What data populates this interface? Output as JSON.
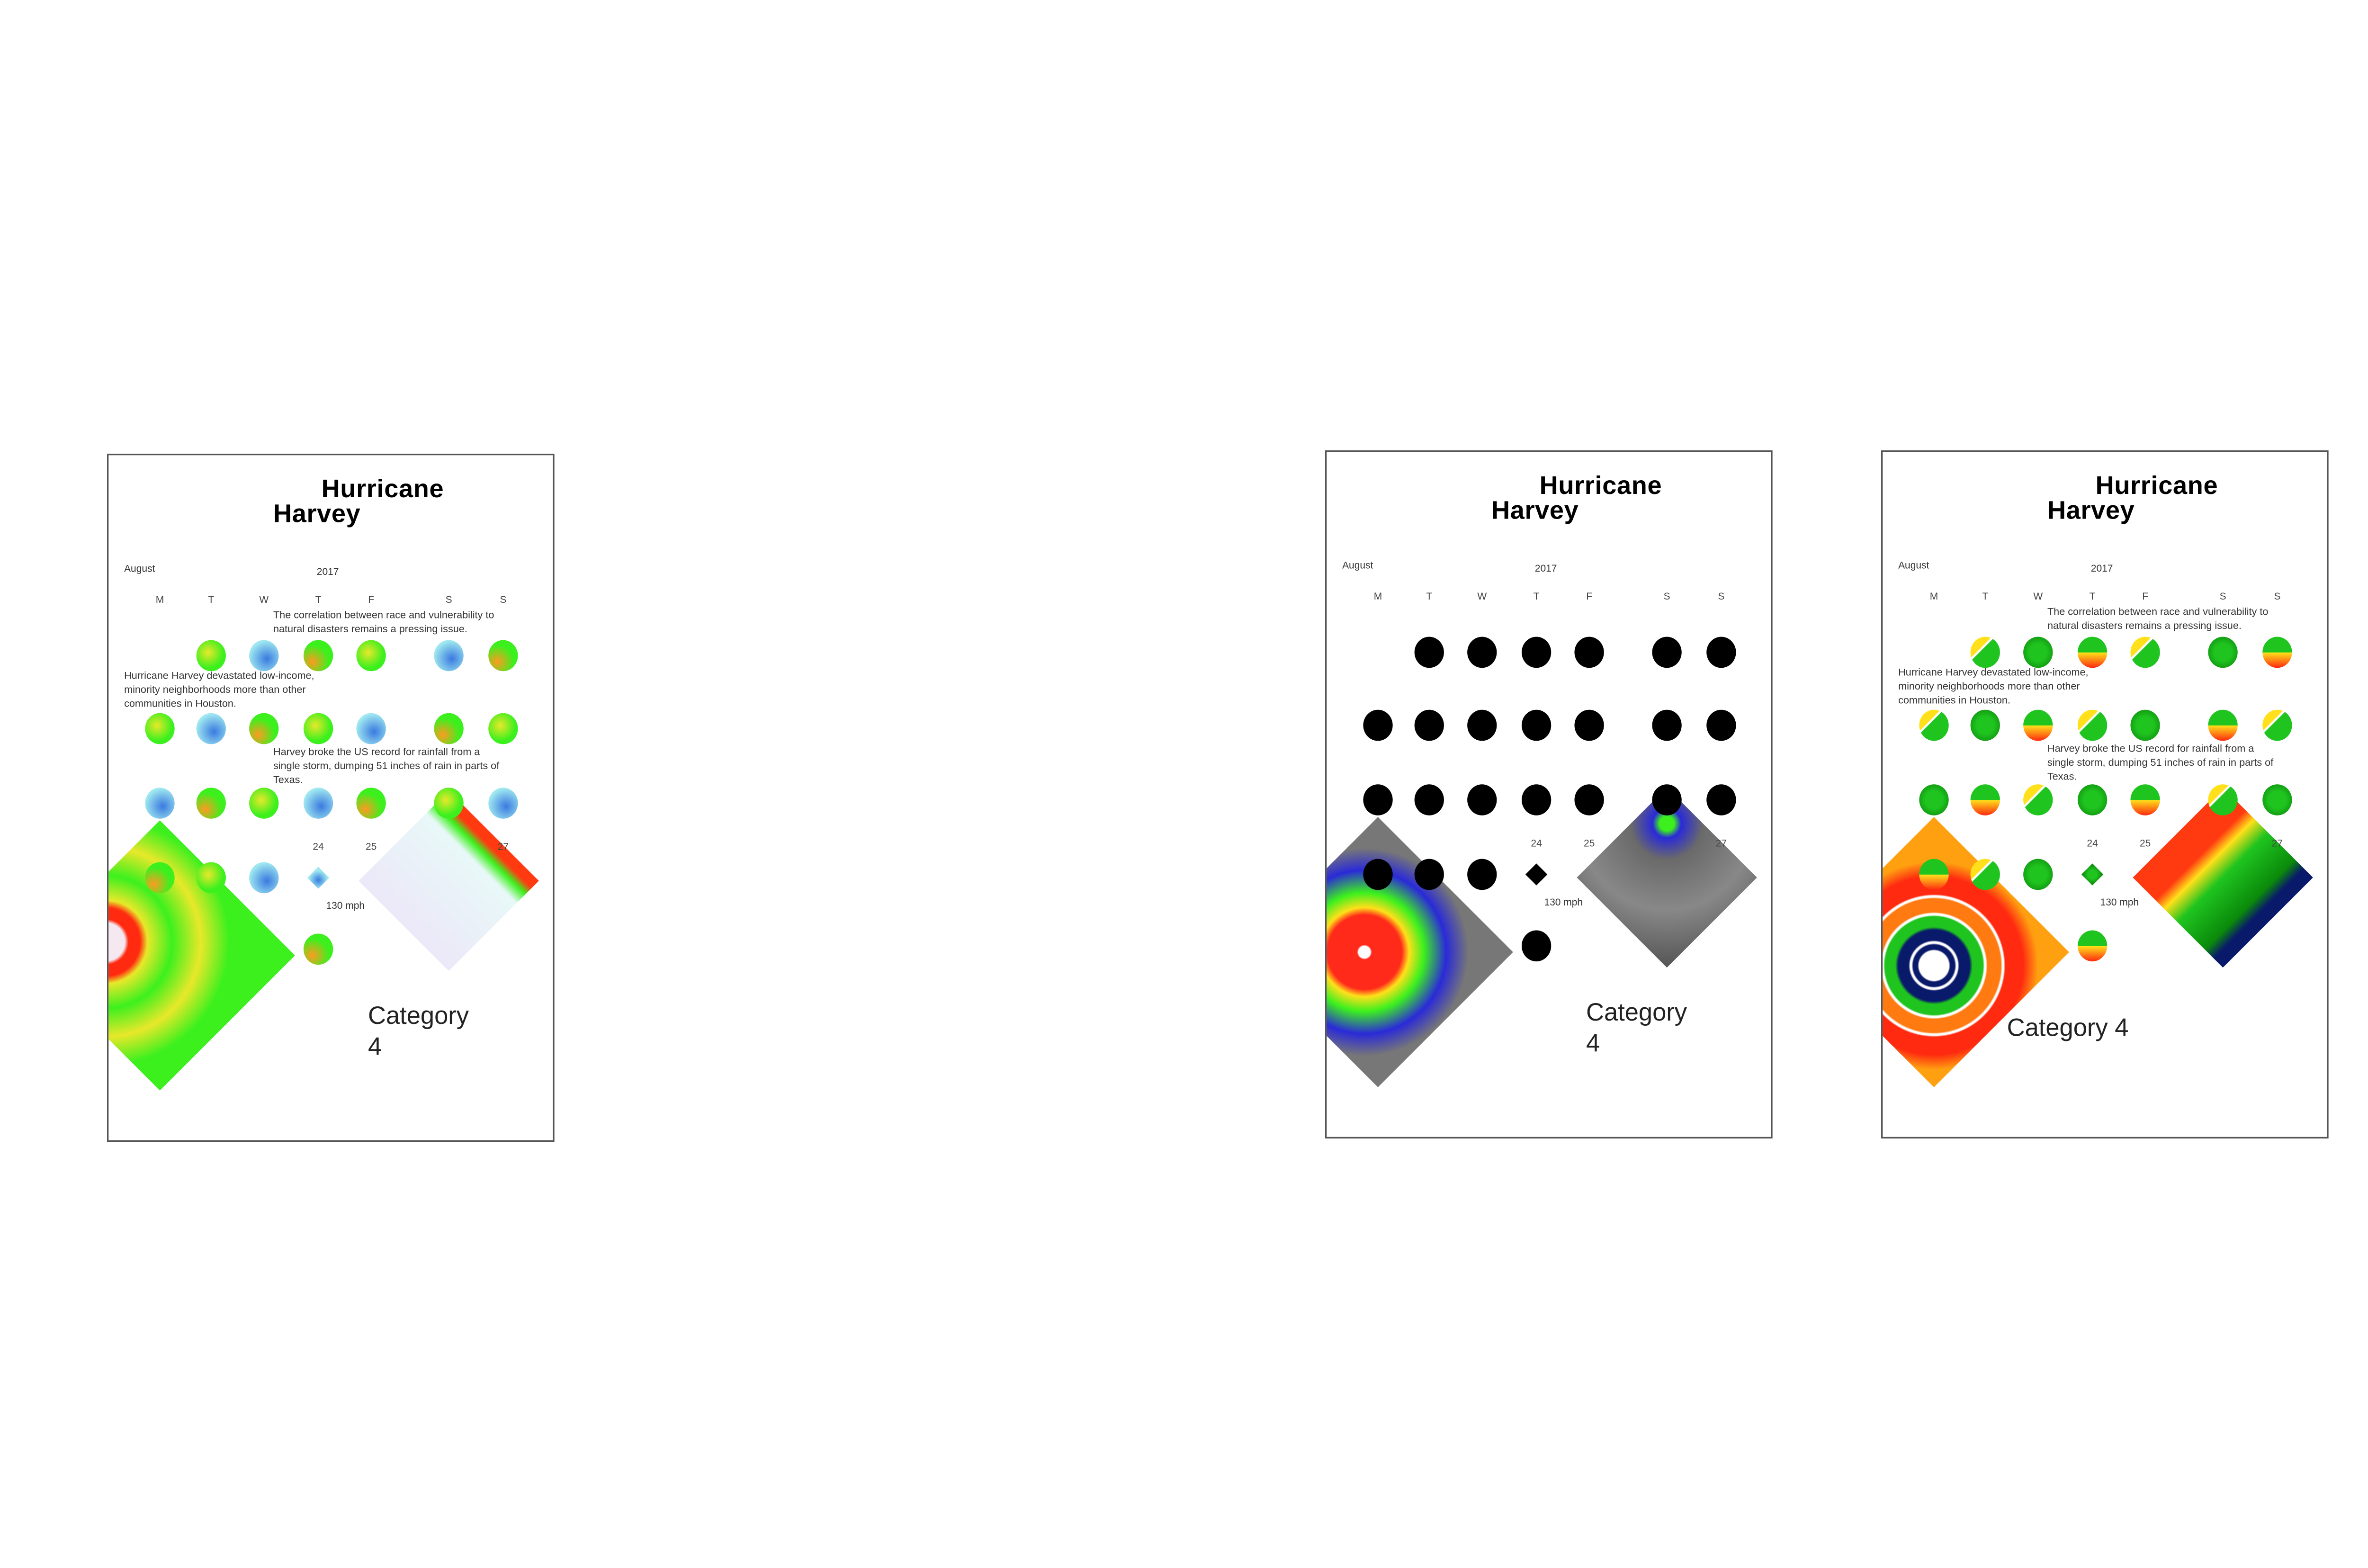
{
  "panels": [
    {
      "variant": "radar",
      "title_line1": "Hurricane",
      "title_line2": "Harvey",
      "month": "August",
      "year": "2017",
      "weekdays": [
        "M",
        "T",
        "W",
        "T",
        "F",
        "S",
        "S"
      ],
      "paragraph1": "The correlation between race and vulnerability to natural disasters remains a pressing issue.",
      "paragraph2": "Hurricane Harvey devastated low-income, minority neighborhoods more than other communities in Houston.",
      "paragraph3": "Harvey broke the US record for rainfall from a single storm, dumping 51 inches of rain in parts of Texas.",
      "date_labels": [
        "24",
        "25",
        "27"
      ],
      "wind_speed": "130 mph",
      "category_label": "Category",
      "category_value": "4",
      "colors": {
        "primary": "#3cf01e",
        "secondary": "#e8e82a",
        "accent": "#3a7ae0",
        "light": "#9fe8f0"
      }
    },
    {
      "variant": "black",
      "title_line1": "Hurricane",
      "title_line2": "Harvey",
      "month": "August",
      "year": "2017",
      "weekdays": [
        "M",
        "T",
        "W",
        "T",
        "F",
        "S",
        "S"
      ],
      "paragraph1": "",
      "paragraph2": "",
      "paragraph3": "",
      "date_labels": [
        "24",
        "25",
        "27"
      ],
      "wind_speed": "130 mph",
      "category_label": "Category",
      "category_value": "4",
      "colors": {
        "primary": "#000000",
        "secondary": "#ff2a1a",
        "accent": "#2a2ad8",
        "light": "#6a6a6a"
      }
    },
    {
      "variant": "heat",
      "title_line1": "Hurricane",
      "title_line2": "Harvey",
      "month": "August",
      "year": "2017",
      "weekdays": [
        "M",
        "T",
        "W",
        "T",
        "F",
        "S",
        "S"
      ],
      "paragraph1": "The correlation between race and vulnerability to natural disasters remains a pressing issue.",
      "paragraph2": "Hurricane Harvey devastated low-income, minority neighborhoods more than other communities in Houston.",
      "paragraph3": "Harvey broke the US record for rainfall from a single storm, dumping 51 inches of rain in parts of Texas.",
      "date_labels": [
        "24",
        "25",
        "27"
      ],
      "wind_speed": "130 mph",
      "category_label": "Category 4",
      "category_value": "",
      "colors": {
        "primary": "#1fc41f",
        "secondary": "#ffe01a",
        "accent": "#ff2a10",
        "light": "#0a1a6a"
      }
    }
  ]
}
